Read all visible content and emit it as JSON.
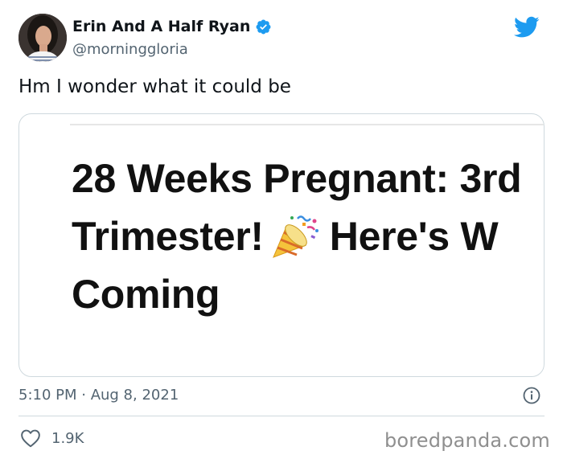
{
  "author": {
    "display_name": "Erin And A Half Ryan",
    "handle": "@morninggloria",
    "verified": true,
    "verified_icon": "verified-badge-icon",
    "avatar": "profile-photo"
  },
  "brand_icon": "twitter-bird-icon",
  "tweet": {
    "text": "Hm I wonder what it could be",
    "card": {
      "headline_lines": [
        "28 Weeks Pregnant: 3rd",
        "Trimester!",
        "Here's W",
        "Coming"
      ],
      "emoji": "party-popper-icon"
    },
    "timestamp": "5:10 PM · Aug 8, 2021",
    "info_icon": "info-icon"
  },
  "engagement": {
    "like_icon": "heart-icon",
    "likes": "1.9K"
  },
  "watermark": "boredpanda.com",
  "colors": {
    "accent": "#1d9bf0",
    "text": "#0f1419",
    "secondary": "#536471",
    "border": "#cfd9de"
  }
}
